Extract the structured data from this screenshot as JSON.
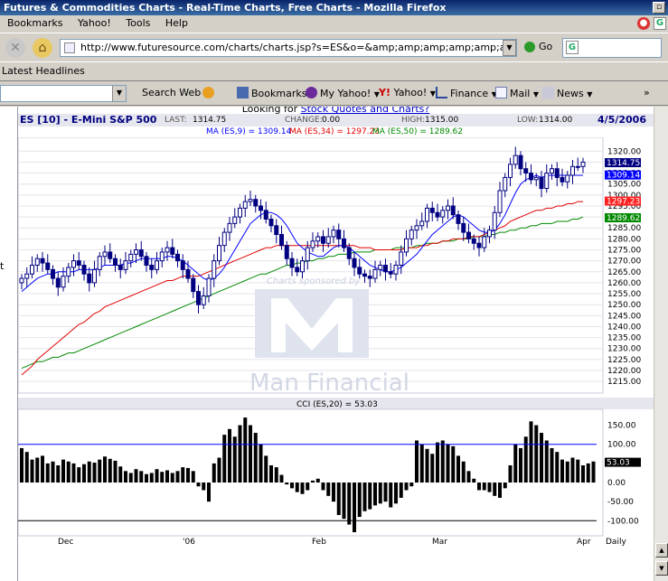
{
  "window": {
    "title": "Futures & Commodities Charts - Real-Time Charts, Free Charts - Mozilla Firefox"
  },
  "menu": [
    "Bookmarks",
    "Yahoo!",
    "Tools",
    "Help"
  ],
  "nav": {
    "url": "http://www.futuresource.com/charts/charts.jsp?s=ES&o=&amp;amp;amp;amp;amp;amp;amp;amp;amp;a=D&",
    "go_label": "Go"
  },
  "headlines_label": "Latest Headlines",
  "yahoo_toolbar": {
    "search_web": "Search Web",
    "bookmarks": "Bookmarks",
    "my_yahoo": "My Yahoo!",
    "yahoo": "Yahoo!",
    "finance": "Finance",
    "mail": "Mail",
    "news": "News"
  },
  "page": {
    "looking_for": "Looking for ",
    "looking_link": "Stock Quotes and Charts?",
    "symbol": "ES [10] - E-Mini S&P 500",
    "last_label": "LAST:",
    "last": "1314.75",
    "change_label": "CHANGE:",
    "change": "0.00",
    "high_label": "HIGH:",
    "high": "1315.00",
    "low_label": "LOW:",
    "low": "1314.00",
    "date": "4/5/2006",
    "ma9": "MA (ES,9) = 1309.14",
    "ma34": "MA (ES,34) = 1297.23",
    "ma50": "MA (ES,50) = 1289.62",
    "sponsor": "Charts sponsored by",
    "sponsor_logo": "Man Financial",
    "cci_label": "CCI (ES,20) = 53.03",
    "periodicity": "Daily"
  },
  "colors": {
    "ma9": "#0000ff",
    "ma34": "#e00000",
    "ma50": "#008800",
    "candle": "#000080",
    "cci_bar": "#000000"
  },
  "chart_data": [
    {
      "type": "candlestick",
      "title": "ES [10] - E-Mini S&P 500",
      "ylim": [
        1213,
        1323
      ],
      "y_ticks": [
        "1320.00",
        "1315.00",
        "1310.00",
        "1305.00",
        "1300.00",
        "1295.00",
        "1290.00",
        "1285.00",
        "1280.00",
        "1275.00",
        "1270.00",
        "1265.00",
        "1260.00",
        "1255.00",
        "1250.00",
        "1245.00",
        "1240.00",
        "1235.00",
        "1230.00",
        "1225.00",
        "1220.00",
        "1215.00"
      ],
      "x_ticks": [
        "Dec",
        "'06",
        "Feb",
        "Mar",
        "Apr"
      ],
      "last_value_tags": [
        {
          "label": "1314.75",
          "value": 1314.75,
          "color": "#000080"
        },
        {
          "label": "1309.14",
          "value": 1309.14,
          "color": "#0000ff"
        },
        {
          "label": "1297.23",
          "value": 1297.23,
          "color": "#e00000"
        },
        {
          "label": "1289.62",
          "value": 1289.62,
          "color": "#008800"
        }
      ],
      "close": [
        1262,
        1264,
        1268,
        1271,
        1269,
        1266,
        1262,
        1258,
        1263,
        1267,
        1270,
        1268,
        1264,
        1260,
        1266,
        1272,
        1274,
        1271,
        1268,
        1266,
        1270,
        1273,
        1275,
        1272,
        1268,
        1266,
        1270,
        1274,
        1276,
        1273,
        1270,
        1266,
        1262,
        1256,
        1250,
        1254,
        1262,
        1270,
        1277,
        1283,
        1287,
        1290,
        1294,
        1297,
        1298,
        1295,
        1293,
        1289,
        1286,
        1282,
        1277,
        1271,
        1267,
        1265,
        1270,
        1276,
        1279,
        1281,
        1278,
        1281,
        1284,
        1280,
        1276,
        1271,
        1267,
        1264,
        1263,
        1262,
        1266,
        1268,
        1265,
        1264,
        1268,
        1274,
        1280,
        1284,
        1286,
        1288,
        1294,
        1292,
        1290,
        1293,
        1295,
        1291,
        1287,
        1283,
        1280,
        1278,
        1276,
        1281,
        1284,
        1292,
        1302,
        1308,
        1314,
        1318,
        1312,
        1310,
        1307,
        1308,
        1303,
        1310,
        1312,
        1308,
        1306,
        1309,
        1313,
        1313,
        1315
      ],
      "ma9": [
        1256,
        1258,
        1260,
        1262,
        1263,
        1264,
        1264,
        1265,
        1265,
        1265,
        1265,
        1266,
        1266,
        1266,
        1266,
        1267,
        1268,
        1268,
        1268,
        1268,
        1269,
        1269,
        1270,
        1271,
        1271,
        1271,
        1271,
        1271,
        1272,
        1272,
        1271,
        1270,
        1268,
        1266,
        1264,
        1262,
        1261,
        1262,
        1264,
        1267,
        1271,
        1275,
        1279,
        1283,
        1287,
        1289,
        1291,
        1292,
        1292,
        1291,
        1289,
        1286,
        1282,
        1278,
        1276,
        1274,
        1273,
        1272,
        1272,
        1274,
        1276,
        1277,
        1277,
        1276,
        1274,
        1272,
        1270,
        1268,
        1267,
        1266,
        1265,
        1265,
        1266,
        1267,
        1269,
        1271,
        1273,
        1276,
        1279,
        1282,
        1284,
        1286,
        1288,
        1290,
        1291,
        1290,
        1288,
        1286,
        1284,
        1283,
        1283,
        1284,
        1287,
        1291,
        1296,
        1301,
        1305,
        1307,
        1308,
        1309,
        1308,
        1309,
        1309,
        1309,
        1309,
        1309,
        1309,
        1309,
        1309
      ],
      "ma34": [
        1218,
        1220,
        1222,
        1225,
        1227,
        1229,
        1231,
        1233,
        1235,
        1237,
        1239,
        1241,
        1242,
        1244,
        1246,
        1247,
        1249,
        1250,
        1251,
        1252,
        1253,
        1254,
        1255,
        1256,
        1257,
        1258,
        1259,
        1260,
        1261,
        1261,
        1262,
        1263,
        1263,
        1263,
        1263,
        1264,
        1265,
        1266,
        1267,
        1268,
        1269,
        1270,
        1271,
        1272,
        1273,
        1274,
        1275,
        1276,
        1276,
        1277,
        1277,
        1277,
        1277,
        1277,
        1277,
        1277,
        1277,
        1277,
        1277,
        1277,
        1277,
        1277,
        1277,
        1277,
        1277,
        1276,
        1276,
        1276,
        1275,
        1275,
        1275,
        1275,
        1275,
        1275,
        1276,
        1276,
        1276,
        1277,
        1277,
        1278,
        1278,
        1279,
        1279,
        1280,
        1280,
        1280,
        1281,
        1281,
        1281,
        1282,
        1283,
        1284,
        1285,
        1286,
        1288,
        1289,
        1290,
        1291,
        1292,
        1293,
        1293,
        1294,
        1294,
        1295,
        1295,
        1296,
        1296,
        1297,
        1297
      ],
      "ma50": [
        1221,
        1222,
        1223,
        1224,
        1224,
        1225,
        1226,
        1226,
        1227,
        1228,
        1228,
        1229,
        1230,
        1231,
        1232,
        1233,
        1234,
        1235,
        1236,
        1237,
        1238,
        1239,
        1240,
        1241,
        1242,
        1243,
        1244,
        1245,
        1246,
        1247,
        1248,
        1249,
        1250,
        1251,
        1252,
        1253,
        1254,
        1255,
        1256,
        1257,
        1258,
        1259,
        1260,
        1261,
        1262,
        1263,
        1264,
        1264,
        1265,
        1266,
        1267,
        1268,
        1268,
        1269,
        1269,
        1270,
        1270,
        1271,
        1271,
        1272,
        1272,
        1273,
        1273,
        1273,
        1274,
        1274,
        1274,
        1274,
        1275,
        1275,
        1275,
        1275,
        1276,
        1276,
        1276,
        1276,
        1277,
        1277,
        1278,
        1278,
        1278,
        1279,
        1279,
        1279,
        1280,
        1280,
        1280,
        1281,
        1281,
        1281,
        1282,
        1282,
        1283,
        1283,
        1284,
        1284,
        1285,
        1285,
        1286,
        1286,
        1287,
        1287,
        1287,
        1288,
        1288,
        1288,
        1289,
        1289,
        1290
      ]
    },
    {
      "type": "bar",
      "title": "CCI (ES,20) = 53.03",
      "ylim": [
        -130,
        175
      ],
      "y_ticks": [
        "150.00",
        "100.00",
        "50.00",
        "0.00",
        "-50.00",
        "-100.00"
      ],
      "ref_lines": [
        100,
        -100
      ],
      "last_value_tags": [
        {
          "label": "53.03",
          "value": 53.03
        }
      ],
      "values": [
        90,
        80,
        60,
        65,
        70,
        50,
        55,
        45,
        60,
        55,
        50,
        40,
        48,
        55,
        52,
        60,
        68,
        62,
        57,
        42,
        30,
        25,
        35,
        30,
        22,
        25,
        35,
        28,
        32,
        25,
        30,
        40,
        38,
        30,
        -10,
        -20,
        -50,
        50,
        65,
        125,
        140,
        120,
        150,
        170,
        150,
        130,
        100,
        70,
        45,
        40,
        20,
        -5,
        -15,
        -25,
        -30,
        -20,
        5,
        10,
        -20,
        -35,
        -50,
        -85,
        -95,
        -110,
        -130,
        -90,
        -75,
        -70,
        -60,
        -55,
        -50,
        -65,
        -55,
        -40,
        -20,
        -10,
        110,
        100,
        88,
        75,
        105,
        110,
        100,
        95,
        70,
        55,
        30,
        10,
        -20,
        -20,
        -25,
        -35,
        -40,
        -15,
        45,
        100,
        90,
        120,
        160,
        150,
        130,
        110,
        90,
        80,
        60,
        55,
        65,
        60,
        45,
        50,
        55
      ]
    }
  ]
}
